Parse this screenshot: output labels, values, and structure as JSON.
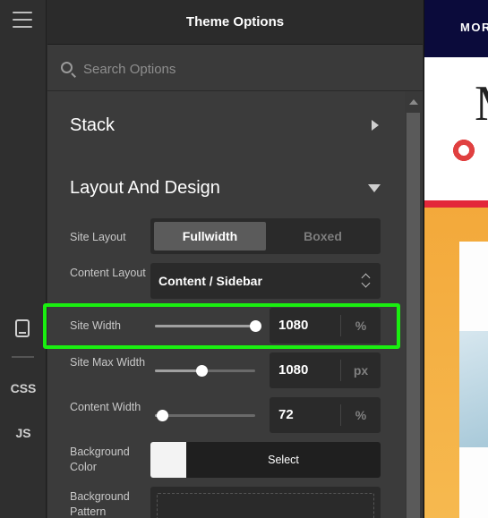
{
  "rail": {
    "menu_icon": "hamburger-icon",
    "device_icon": "mobile-device-icon",
    "css_label": "CSS",
    "js_label": "JS"
  },
  "panel": {
    "title": "Theme Options",
    "search_placeholder": "Search Options",
    "sections": [
      {
        "title": "Stack",
        "expanded": false
      },
      {
        "title": "Layout And Design",
        "expanded": true
      }
    ],
    "site_layout": {
      "label": "Site Layout",
      "options": [
        "Fullwidth",
        "Boxed"
      ],
      "selected": "Fullwidth"
    },
    "content_layout": {
      "label": "Content Layout",
      "value": "Content / Sidebar"
    },
    "site_width": {
      "label": "Site Width",
      "value": "1080",
      "unit": "%",
      "slider_fraction": 1.0
    },
    "site_max_width": {
      "label": "Site Max Width",
      "value": "1080",
      "unit": "px",
      "slider_fraction": 0.46
    },
    "content_width": {
      "label": "Content Width",
      "value": "72",
      "unit": "%",
      "slider_fraction": 0.07
    },
    "background_color": {
      "label": "Background Color",
      "button": "Select",
      "swatch": "#f3f3f3"
    },
    "background_pattern": {
      "label": "Background Pattern"
    }
  },
  "preview": {
    "nav_text": "MOR",
    "hero_letter": "M"
  },
  "colors": {
    "highlight": "#1aef10",
    "panel_bg": "#3b3b3b",
    "accent_red": "#e3273a",
    "preview_nav": "#0b0b3b"
  }
}
